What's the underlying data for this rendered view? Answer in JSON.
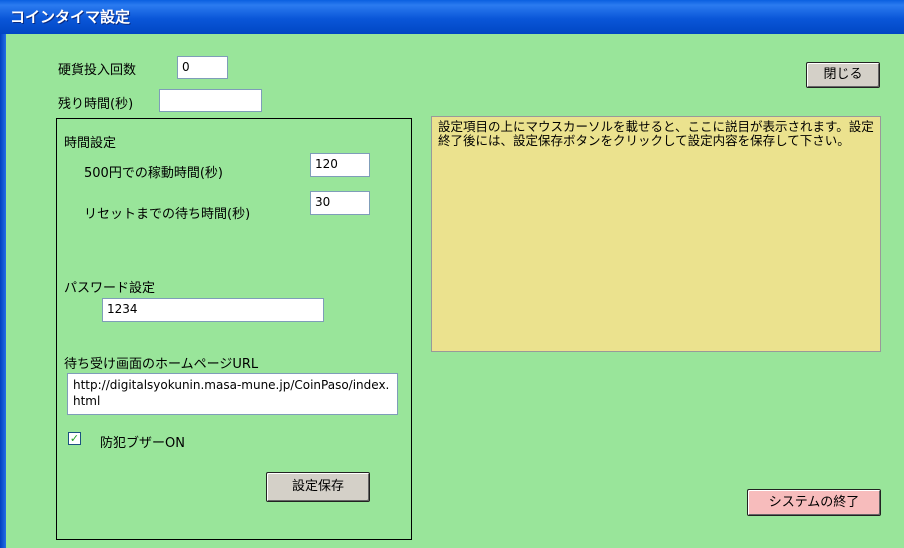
{
  "window": {
    "title": "コインタイマ設定"
  },
  "coin_count": {
    "label": "硬貨投入回数",
    "value": "0"
  },
  "remaining_time": {
    "label": "残り時間(秒)",
    "value": ""
  },
  "time_settings": {
    "heading": "時間設定",
    "run_time": {
      "label": "500円での稼動時間(秒)",
      "value": "120"
    },
    "reset_wait": {
      "label": "リセットまでの待ち時間(秒)",
      "value": "30"
    }
  },
  "password": {
    "label": "パスワード設定",
    "value": "1234"
  },
  "homepage": {
    "label": "待ち受け画面のホームページURL",
    "value": "http://digitalsyokunin.masa-mune.jp/CoinPaso/index.html"
  },
  "buzzer": {
    "label": "防犯ブザーON",
    "checked": true
  },
  "buttons": {
    "close": "閉じる",
    "save": "設定保存",
    "exit": "システムの終了"
  },
  "help_text": "設定項目の上にマウスカーソルを載せると、ここに説目が表示されます。設定終了後には、設定保存ボタンをクリックして設定内容を保存して下さい。",
  "colors": {
    "background": "#99e59a",
    "help_background": "#ebe28e",
    "exit_button": "#f7bcbc",
    "button": "#d4d0c8"
  }
}
